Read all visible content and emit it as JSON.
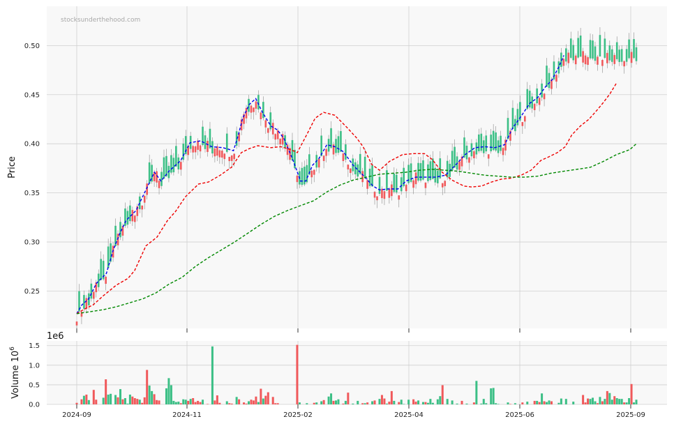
{
  "watermark": "stocksunderthehood.com",
  "colors": {
    "up": "#3cbf86",
    "down": "#f0595b",
    "ema_short": "#0000ee",
    "ema_mid": "#ee0000",
    "ema_long": "#008800",
    "panel_bg": "#f8f8f8",
    "grid": "#d0d0d0"
  },
  "chart_data": [
    {
      "type": "candlestick",
      "ylabel": "Price",
      "ylim": [
        0.212,
        0.54
      ],
      "yticks": [
        "0.25",
        "0.30",
        "0.35",
        "0.40",
        "0.45",
        "0.50"
      ],
      "xticks": [
        "2024-09",
        "2024-11",
        "2025-02",
        "2025-04",
        "2025-06",
        "2025-09"
      ],
      "grid": true,
      "series": [
        {
          "style": "dashed",
          "color": "blue",
          "points": [
            [
              0,
              0.227
            ],
            [
              8,
              0.236
            ],
            [
              18,
              0.242
            ],
            [
              30,
              0.258
            ],
            [
              45,
              0.268
            ],
            [
              55,
              0.291
            ],
            [
              65,
              0.308
            ],
            [
              75,
              0.322
            ],
            [
              90,
              0.332
            ],
            [
              105,
              0.353
            ],
            [
              118,
              0.371
            ],
            [
              128,
              0.362
            ],
            [
              140,
              0.372
            ],
            [
              158,
              0.383
            ],
            [
              172,
              0.401
            ],
            [
              188,
              0.403
            ],
            [
              205,
              0.397
            ],
            [
              222,
              0.396
            ],
            [
              238,
              0.393
            ],
            [
              245,
              0.408
            ],
            [
              252,
              0.426
            ],
            [
              262,
              0.44
            ],
            [
              272,
              0.446
            ],
            [
              282,
              0.432
            ],
            [
              295,
              0.418
            ],
            [
              305,
              0.414
            ],
            [
              315,
              0.405
            ],
            [
              328,
              0.384
            ],
            [
              340,
              0.362
            ],
            [
              348,
              0.362
            ],
            [
              358,
              0.378
            ],
            [
              368,
              0.385
            ],
            [
              380,
              0.399
            ],
            [
              392,
              0.397
            ],
            [
              405,
              0.392
            ],
            [
              420,
              0.378
            ],
            [
              435,
              0.368
            ],
            [
              450,
              0.357
            ],
            [
              460,
              0.353
            ],
            [
              472,
              0.354
            ],
            [
              488,
              0.354
            ],
            [
              500,
              0.362
            ],
            [
              515,
              0.366
            ],
            [
              530,
              0.366
            ],
            [
              545,
              0.366
            ],
            [
              560,
              0.368
            ],
            [
              575,
              0.378
            ],
            [
              590,
              0.389
            ],
            [
              605,
              0.396
            ],
            [
              620,
              0.397
            ],
            [
              635,
              0.396
            ],
            [
              650,
              0.399
            ],
            [
              662,
              0.416
            ],
            [
              675,
              0.428
            ],
            [
              688,
              0.441
            ],
            [
              700,
              0.447
            ],
            [
              712,
              0.458
            ],
            [
              722,
              0.465
            ],
            [
              732,
              0.478
            ],
            [
              740,
              0.49
            ]
          ]
        },
        {
          "style": "dashed",
          "color": "red",
          "points": [
            [
              0,
              0.227
            ],
            [
              10,
              0.231
            ],
            [
              25,
              0.236
            ],
            [
              40,
              0.245
            ],
            [
              60,
              0.256
            ],
            [
              78,
              0.263
            ],
            [
              88,
              0.271
            ],
            [
              105,
              0.296
            ],
            [
              122,
              0.305
            ],
            [
              138,
              0.322
            ],
            [
              150,
              0.331
            ],
            [
              165,
              0.346
            ],
            [
              185,
              0.359
            ],
            [
              200,
              0.361
            ],
            [
              218,
              0.368
            ],
            [
              235,
              0.376
            ],
            [
              250,
              0.391
            ],
            [
              262,
              0.395
            ],
            [
              275,
              0.398
            ],
            [
              295,
              0.396
            ],
            [
              310,
              0.397
            ],
            [
              325,
              0.394
            ],
            [
              335,
              0.391
            ],
            [
              350,
              0.41
            ],
            [
              362,
              0.426
            ],
            [
              375,
              0.432
            ],
            [
              392,
              0.429
            ],
            [
              410,
              0.417
            ],
            [
              425,
              0.406
            ],
            [
              435,
              0.397
            ],
            [
              448,
              0.379
            ],
            [
              460,
              0.373
            ],
            [
              475,
              0.382
            ],
            [
              495,
              0.389
            ],
            [
              512,
              0.39
            ],
            [
              528,
              0.39
            ],
            [
              540,
              0.384
            ],
            [
              555,
              0.371
            ],
            [
              570,
              0.363
            ],
            [
              588,
              0.357
            ],
            [
              600,
              0.356
            ],
            [
              615,
              0.357
            ],
            [
              630,
              0.361
            ],
            [
              645,
              0.364
            ],
            [
              660,
              0.365
            ],
            [
              675,
              0.368
            ],
            [
              690,
              0.373
            ],
            [
              705,
              0.383
            ],
            [
              718,
              0.387
            ],
            [
              730,
              0.391
            ],
            [
              742,
              0.397
            ],
            [
              752,
              0.409
            ],
            [
              765,
              0.418
            ],
            [
              778,
              0.425
            ],
            [
              790,
              0.434
            ],
            [
              800,
              0.442
            ],
            [
              810,
              0.451
            ],
            [
              820,
              0.462
            ]
          ]
        },
        {
          "style": "dashed",
          "color": "green",
          "points": [
            [
              0,
              0.227
            ],
            [
              20,
              0.229
            ],
            [
              40,
              0.231
            ],
            [
              60,
              0.234
            ],
            [
              80,
              0.238
            ],
            [
              100,
              0.242
            ],
            [
              120,
              0.248
            ],
            [
              140,
              0.257
            ],
            [
              160,
              0.264
            ],
            [
              180,
              0.275
            ],
            [
              200,
              0.284
            ],
            [
              220,
              0.292
            ],
            [
              240,
              0.3
            ],
            [
              260,
              0.309
            ],
            [
              280,
              0.318
            ],
            [
              300,
              0.326
            ],
            [
              320,
              0.332
            ],
            [
              340,
              0.337
            ],
            [
              360,
              0.342
            ],
            [
              380,
              0.351
            ],
            [
              400,
              0.358
            ],
            [
              420,
              0.363
            ],
            [
              440,
              0.366
            ],
            [
              460,
              0.369
            ],
            [
              480,
              0.37
            ],
            [
              500,
              0.371
            ],
            [
              520,
              0.373
            ],
            [
              540,
              0.374
            ],
            [
              560,
              0.373
            ],
            [
              580,
              0.372
            ],
            [
              600,
              0.37
            ],
            [
              620,
              0.368
            ],
            [
              640,
              0.367
            ],
            [
              660,
              0.366
            ],
            [
              680,
              0.366
            ],
            [
              700,
              0.367
            ],
            [
              720,
              0.37
            ],
            [
              740,
              0.372
            ],
            [
              760,
              0.374
            ],
            [
              780,
              0.376
            ],
            [
              800,
              0.382
            ],
            [
              820,
              0.389
            ],
            [
              840,
              0.394
            ],
            [
              850,
              0.4
            ]
          ]
        }
      ]
    },
    {
      "type": "bar",
      "ylabel": "Volume  10",
      "ylabel_exponent": "6",
      "offset_text": "1e6",
      "ylim": [
        0,
        1.62
      ],
      "yticks": [
        "0.0",
        "0.5",
        "1.0",
        "1.5"
      ],
      "values": [
        0.04,
        0.0,
        0.13,
        0.22,
        0.25,
        0.11,
        0.0,
        0.37,
        0.12,
        0.0,
        0.0,
        0.17,
        0.64,
        0.25,
        0.27,
        0.0,
        0.24,
        0.18,
        0.39,
        0.13,
        0.16,
        0.02,
        0.25,
        0.2,
        0.16,
        0.14,
        0.12,
        0.04,
        0.18,
        0.88,
        0.48,
        0.34,
        0.26,
        0.11,
        0.1,
        0.0,
        0.0,
        0.41,
        0.67,
        0.49,
        0.09,
        0.06,
        0.07,
        0.03,
        0.13,
        0.12,
        0.09,
        0.14,
        0.16,
        0.06,
        0.09,
        0.06,
        0.12,
        0.0,
        0.01,
        0.0,
        1.48,
        0.1,
        0.23,
        0.04,
        0.0,
        0.0,
        0.08,
        0.03,
        0.02,
        0.0,
        0.19,
        0.13,
        0.0,
        0.05,
        0.02,
        0.08,
        0.12,
        0.1,
        0.2,
        0.06,
        0.4,
        0.15,
        0.22,
        0.31,
        0.0,
        0.19,
        0.03,
        0.03,
        0.0,
        0.0,
        0.0,
        0.0,
        0.0,
        0.0,
        0.0,
        1.52,
        0.05,
        0.0,
        0.0,
        0.03,
        0.0,
        0.0,
        0.04,
        0.05,
        0.0,
        0.08,
        0.11,
        0.0,
        0.2,
        0.28,
        0.09,
        0.1,
        0.13,
        0.0,
        0.02,
        0.09,
        0.3,
        0.0,
        0.02,
        0.0,
        0.09,
        0.0,
        0.03,
        0.03,
        0.05,
        0.0,
        0.08,
        0.1,
        0.0,
        0.14,
        0.24,
        0.15,
        0.02,
        0.07,
        0.34,
        0.09,
        0.0,
        0.06,
        0.12,
        0.01,
        0.0,
        0.12,
        0.0,
        0.13,
        0.07,
        0.1,
        0.0,
        0.06,
        0.06,
        0.04,
        0.14,
        0.04,
        0.0,
        0.13,
        0.21,
        0.49,
        0.0,
        0.14,
        0.0,
        0.1,
        0.0,
        0.02,
        0.0,
        0.09,
        0.0,
        0.02,
        0.0,
        0.0,
        0.05,
        0.6,
        0.0,
        0.02,
        0.14,
        0.03,
        0.0,
        0.41,
        0.42,
        0.03,
        0.01,
        0.0,
        0.0,
        0.0,
        0.05,
        0.01,
        0.0,
        0.03,
        0.0,
        0.0,
        0.05,
        0.0,
        0.07,
        0.0,
        0.0,
        0.09,
        0.09,
        0.06,
        0.28,
        0.08,
        0.06,
        0.1,
        0.08,
        0.0,
        0.0,
        0.04,
        0.15,
        0.0,
        0.14,
        0.0,
        0.0,
        0.07,
        0.0,
        0.0,
        0.0,
        0.24,
        0.05,
        0.15,
        0.14,
        0.17,
        0.08,
        0.03,
        0.19,
        0.08,
        0.14,
        0.34,
        0.29,
        0.12,
        0.21,
        0.16,
        0.14,
        0.14,
        0.05,
        0.05,
        0.16,
        0.52,
        0.05,
        0.12
      ],
      "grid": true
    }
  ]
}
